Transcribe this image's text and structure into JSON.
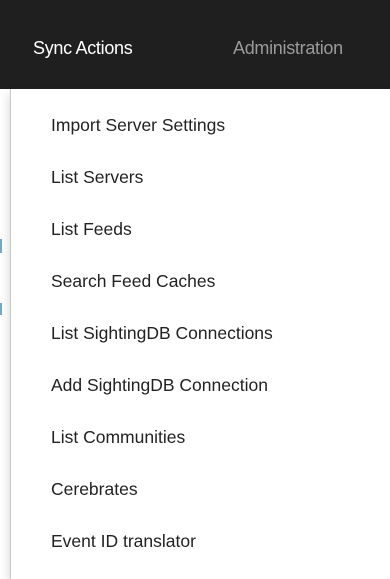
{
  "navbar": {
    "tabs": [
      {
        "label": "Sync Actions",
        "active": true
      },
      {
        "label": "Administration",
        "active": false
      }
    ]
  },
  "dropdown": {
    "items": [
      {
        "label": "Import Server Settings"
      },
      {
        "label": "List Servers"
      },
      {
        "label": "List Feeds"
      },
      {
        "label": "Search Feed Caches"
      },
      {
        "label": "List SightingDB Connections"
      },
      {
        "label": "Add SightingDB Connection"
      },
      {
        "label": "List Communities"
      },
      {
        "label": "Cerebrates"
      },
      {
        "label": "Event ID translator"
      }
    ]
  },
  "colors": {
    "navbar_bg": "#1f1f1f",
    "active_tab_text": "#ffffff",
    "inactive_tab_text": "#9a9a9a",
    "menu_text": "#222222",
    "menu_bg": "#ffffff"
  }
}
